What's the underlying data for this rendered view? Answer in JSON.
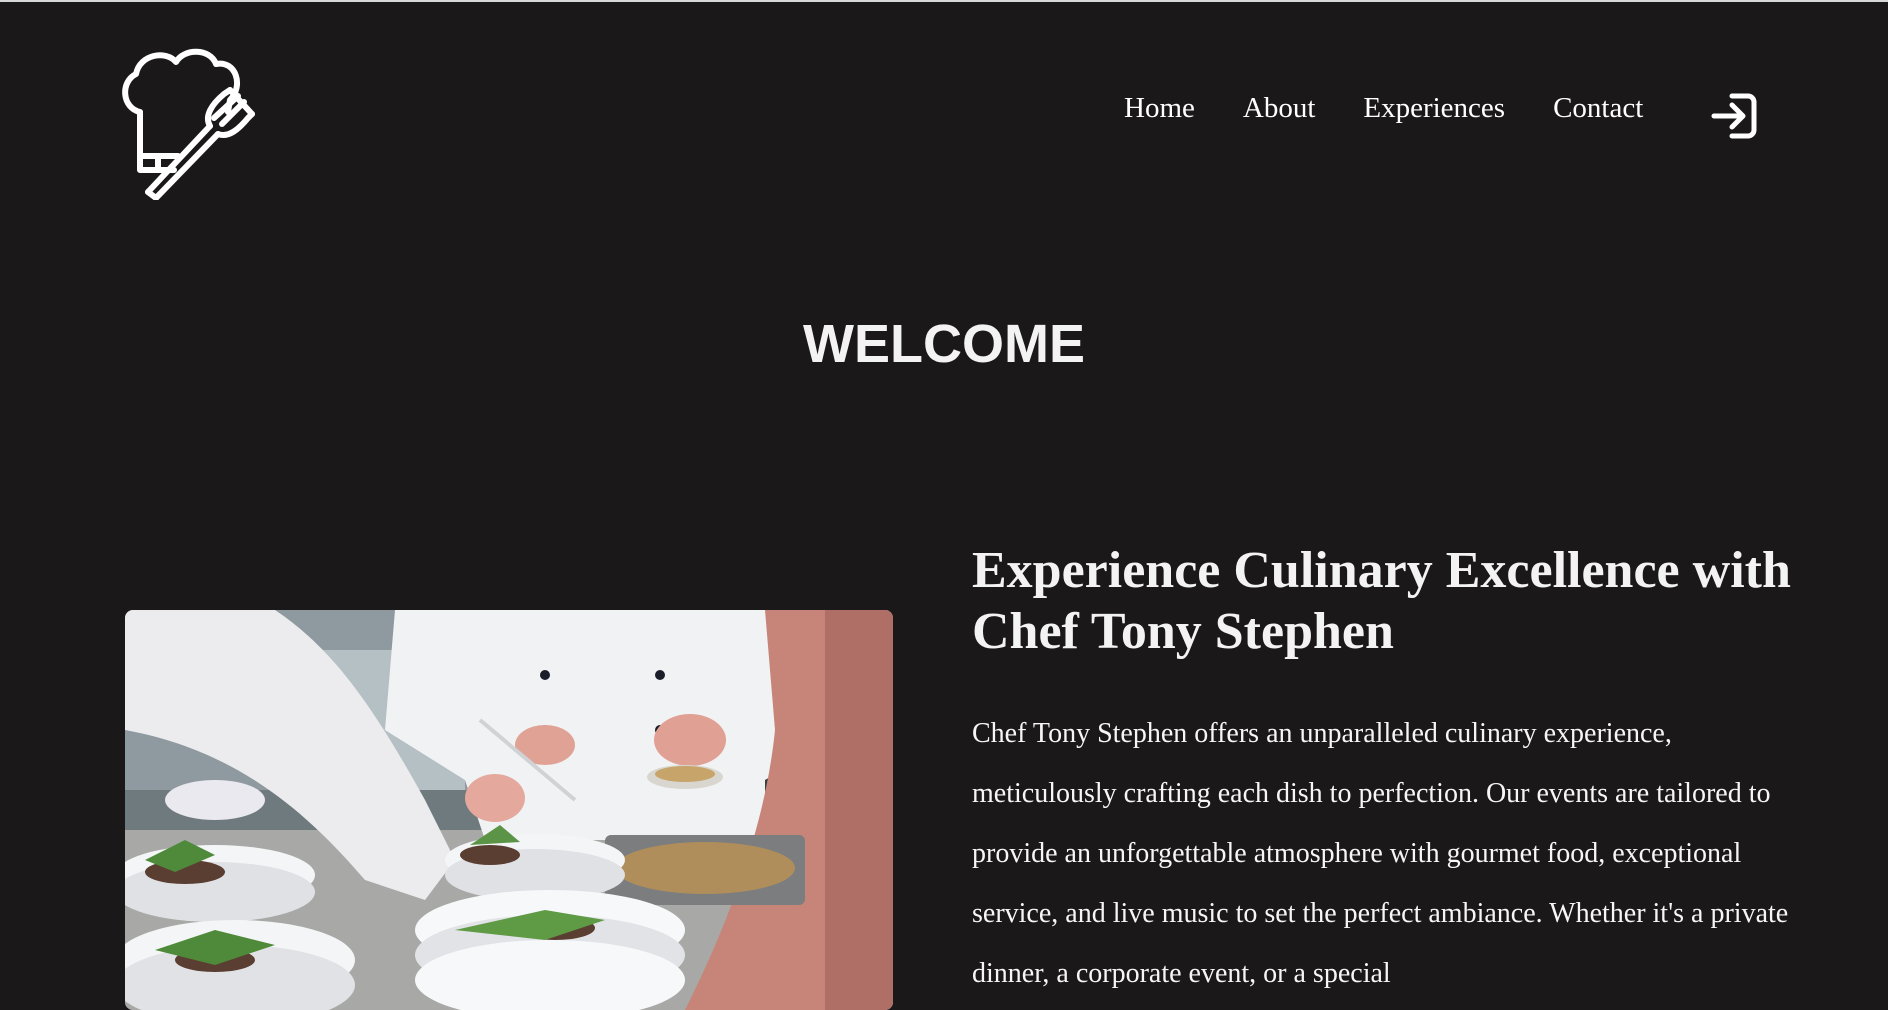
{
  "nav": {
    "items": [
      {
        "label": "Home"
      },
      {
        "label": "About"
      },
      {
        "label": "Experiences"
      },
      {
        "label": "Contact"
      }
    ],
    "login_icon": "login-arrow-icon"
  },
  "logo": {
    "icon": "chef-hat-fork-icon"
  },
  "hero": {
    "title": "WELCOME"
  },
  "intro": {
    "heading": "Experience Culinary Excellence with Chef Tony Stephen",
    "body": "Chef Tony Stephen offers an unparalleled culinary experience, meticulously crafting each dish to perfection. Our events are tailored to provide an unforgettable atmosphere with gourmet food, exceptional service, and live music to set the perfect ambiance. Whether it's a private dinner, a corporate event, or a special"
  },
  "colors": {
    "background": "#1b181a",
    "text": "#f3f3f3"
  }
}
